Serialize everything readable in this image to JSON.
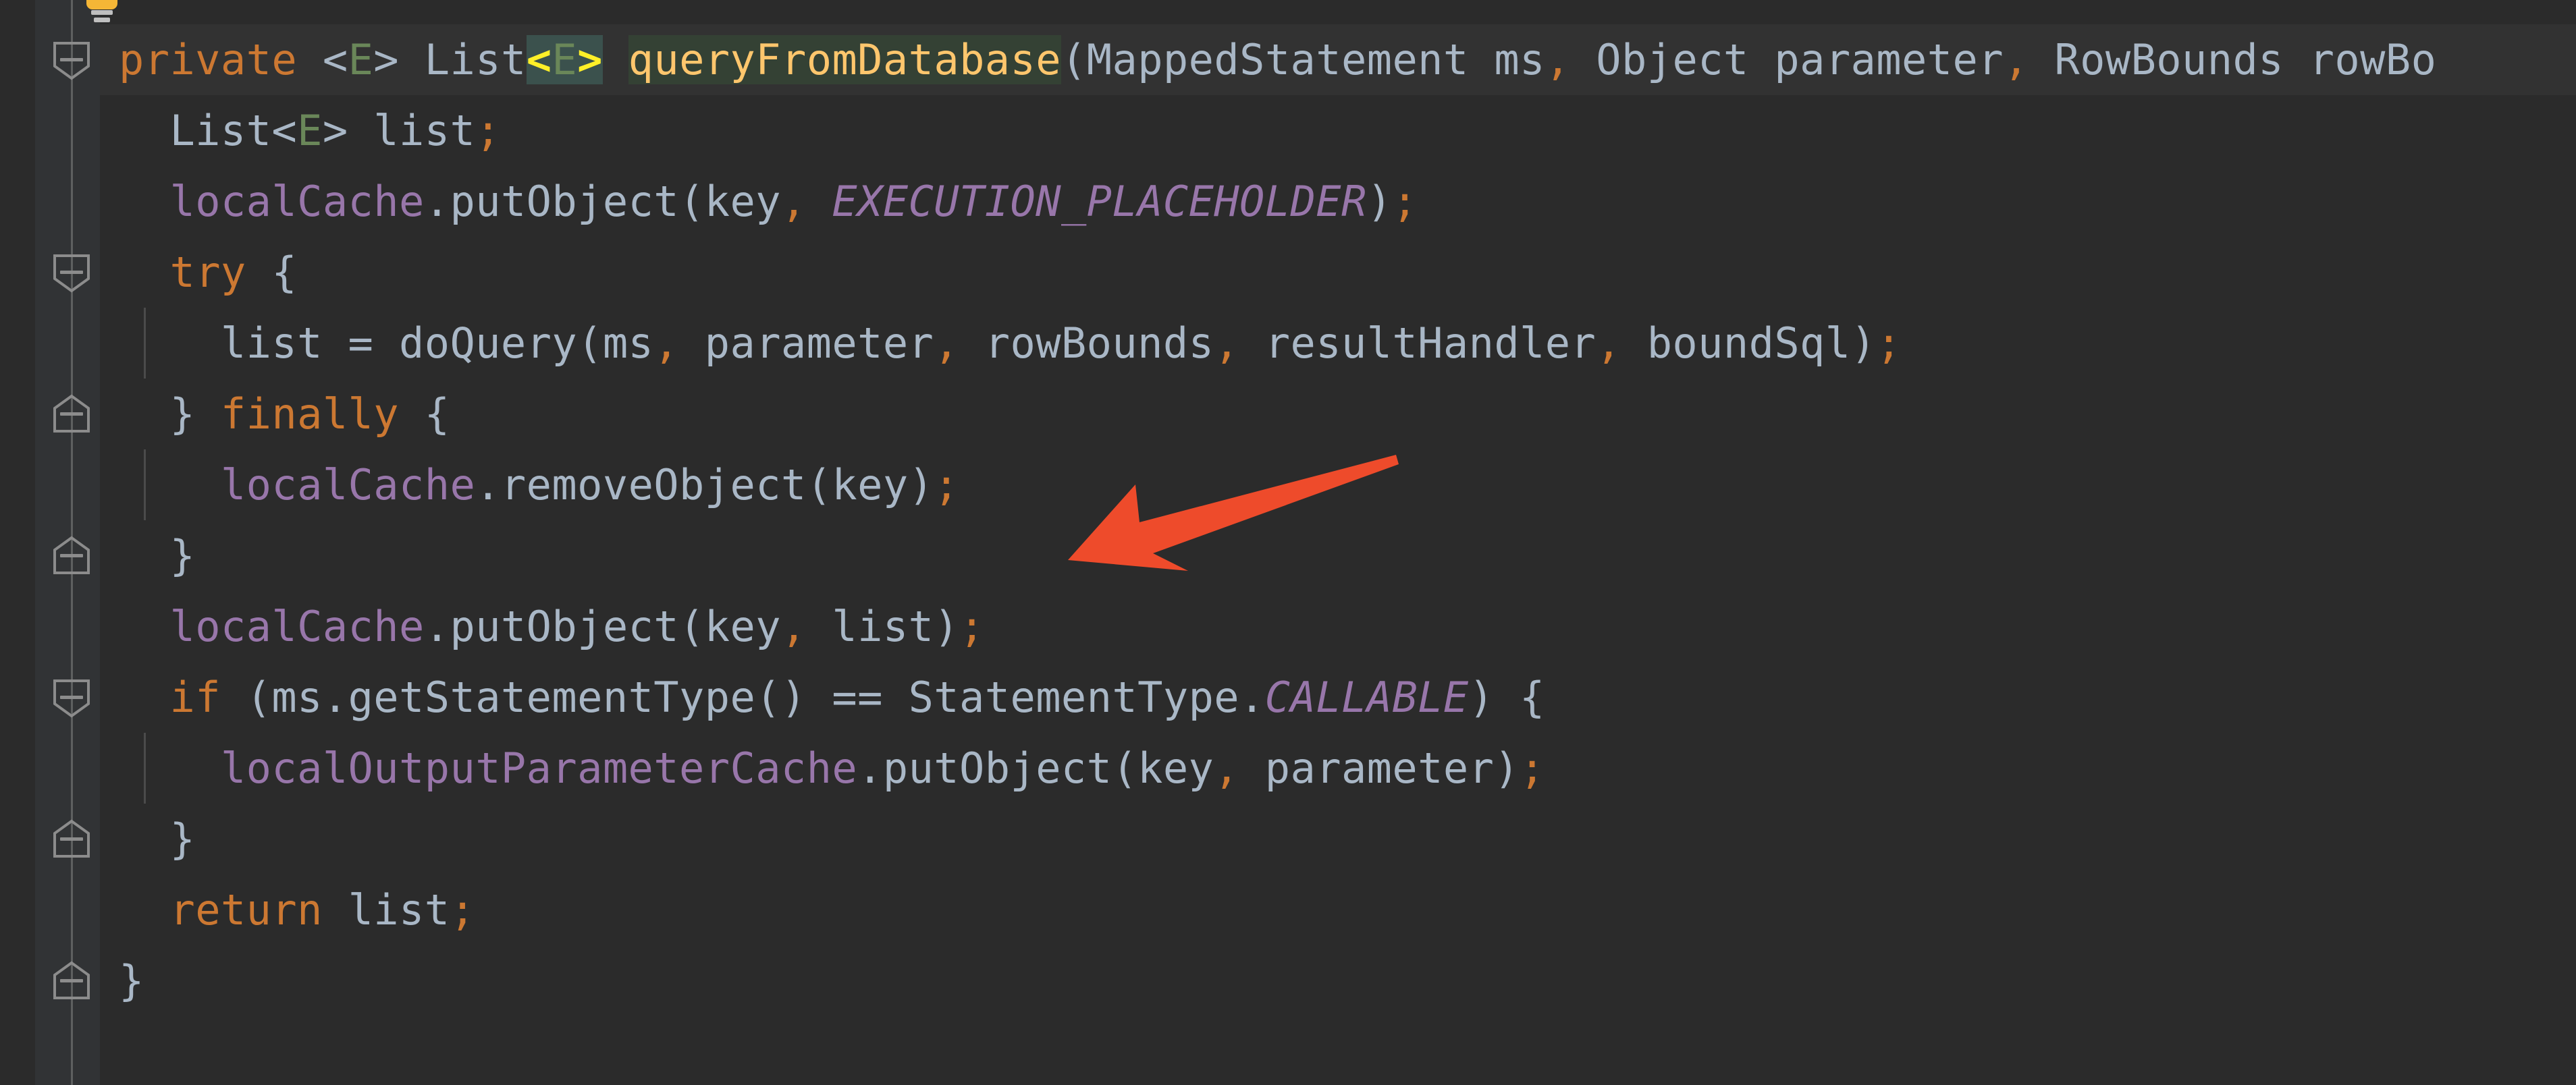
{
  "app": {
    "kind": "code-editor",
    "theme": "darcula",
    "background": "#2B2B2B",
    "gutter_background": "#313335",
    "caret_line_background": "#323232"
  },
  "colors": {
    "keyword": "#CC7832",
    "identifier": "#A9B7C6",
    "field": "#9876AA",
    "static_field": "#9876AA",
    "method": "#FFC66D",
    "generic_param": "#6A8759",
    "punctuation": "#CC7832",
    "usage_highlight": "#344134",
    "bracket_match": "#3B514D",
    "bracket_caret": "#FFEF28",
    "annotation_arrow": "#EE4B2B",
    "bulb": "#F5B636",
    "fold_marker": "#8C8C8C"
  },
  "gutter": {
    "bulb_icon": "lightbulb-intention-icon",
    "fold_markers": [
      {
        "name": "fold-marker-method",
        "direction": "down",
        "glyph": "minus"
      },
      {
        "name": "fold-marker-try",
        "direction": "down",
        "glyph": "minus"
      },
      {
        "name": "fold-marker-finally",
        "direction": "up",
        "glyph": "minus"
      },
      {
        "name": "fold-marker-finally-end",
        "direction": "up",
        "glyph": "minus"
      },
      {
        "name": "fold-marker-if",
        "direction": "down",
        "glyph": "minus"
      },
      {
        "name": "fold-marker-if-end",
        "direction": "up",
        "glyph": "minus"
      },
      {
        "name": "fold-marker-method-end",
        "direction": "up",
        "glyph": "minus"
      }
    ]
  },
  "annotation": {
    "arrow_name": "red-annotation-arrow",
    "color": "#EE4B2B",
    "points_to": "closing brace of finally block",
    "direction": "left-down"
  },
  "code": {
    "language": "java",
    "caret_line_index": 0,
    "lines": [
      {
        "indent_guides": 0,
        "caret": true,
        "tokens": [
          {
            "t": "private",
            "c": "kw"
          },
          {
            "t": " ",
            "c": "id"
          },
          {
            "t": "<",
            "c": "id"
          },
          {
            "t": "E",
            "c": "gen"
          },
          {
            "t": "> ",
            "c": "id"
          },
          {
            "t": "List",
            "c": "id"
          },
          {
            "t": "<",
            "c": "br-y"
          },
          {
            "t": "E",
            "c": "gen hl-brk"
          },
          {
            "t": ">",
            "c": "br-y"
          },
          {
            "t": " ",
            "c": "id"
          },
          {
            "t": "queryFromDatabase",
            "c": "mth hl-usage"
          },
          {
            "t": "(",
            "c": "id"
          },
          {
            "t": "MappedStatement ms",
            "c": "id"
          },
          {
            "t": ",",
            "c": "pn"
          },
          {
            "t": " Object parameter",
            "c": "id"
          },
          {
            "t": ",",
            "c": "pn"
          },
          {
            "t": " RowBounds rowBo",
            "c": "id"
          }
        ]
      },
      {
        "indent_guides": 0,
        "caret": false,
        "tokens": [
          {
            "t": "  List",
            "c": "id"
          },
          {
            "t": "<",
            "c": "id"
          },
          {
            "t": "E",
            "c": "gen"
          },
          {
            "t": "> list",
            "c": "id"
          },
          {
            "t": ";",
            "c": "pn"
          }
        ]
      },
      {
        "indent_guides": 0,
        "caret": false,
        "tokens": [
          {
            "t": "  ",
            "c": "id"
          },
          {
            "t": "localCache",
            "c": "fld"
          },
          {
            "t": ".putObject(key",
            "c": "id"
          },
          {
            "t": ",",
            "c": "pn"
          },
          {
            "t": " ",
            "c": "id"
          },
          {
            "t": "EXECUTION_PLACEHOLDER",
            "c": "sfld"
          },
          {
            "t": ")",
            "c": "id"
          },
          {
            "t": ";",
            "c": "pn"
          }
        ]
      },
      {
        "indent_guides": 0,
        "caret": false,
        "tokens": [
          {
            "t": "  ",
            "c": "id"
          },
          {
            "t": "try",
            "c": "kw"
          },
          {
            "t": " {",
            "c": "id"
          }
        ]
      },
      {
        "indent_guides": 1,
        "caret": false,
        "tokens": [
          {
            "t": "    list = doQuery(ms",
            "c": "id"
          },
          {
            "t": ",",
            "c": "pn"
          },
          {
            "t": " parameter",
            "c": "id"
          },
          {
            "t": ",",
            "c": "pn"
          },
          {
            "t": " rowBounds",
            "c": "id"
          },
          {
            "t": ",",
            "c": "pn"
          },
          {
            "t": " resultHandler",
            "c": "id"
          },
          {
            "t": ",",
            "c": "pn"
          },
          {
            "t": " boundSql)",
            "c": "id"
          },
          {
            "t": ";",
            "c": "pn"
          }
        ]
      },
      {
        "indent_guides": 0,
        "caret": false,
        "tokens": [
          {
            "t": "  } ",
            "c": "id"
          },
          {
            "t": "finally",
            "c": "kw"
          },
          {
            "t": " {",
            "c": "id"
          }
        ]
      },
      {
        "indent_guides": 1,
        "caret": false,
        "tokens": [
          {
            "t": "    ",
            "c": "id"
          },
          {
            "t": "localCache",
            "c": "fld"
          },
          {
            "t": ".removeObject(key)",
            "c": "id"
          },
          {
            "t": ";",
            "c": "pn"
          }
        ]
      },
      {
        "indent_guides": 0,
        "caret": false,
        "tokens": [
          {
            "t": "  }",
            "c": "id"
          }
        ]
      },
      {
        "indent_guides": 0,
        "caret": false,
        "tokens": [
          {
            "t": "  ",
            "c": "id"
          },
          {
            "t": "localCache",
            "c": "fld"
          },
          {
            "t": ".putObject(key",
            "c": "id"
          },
          {
            "t": ",",
            "c": "pn"
          },
          {
            "t": " list)",
            "c": "id"
          },
          {
            "t": ";",
            "c": "pn"
          }
        ]
      },
      {
        "indent_guides": 0,
        "caret": false,
        "tokens": [
          {
            "t": "  ",
            "c": "id"
          },
          {
            "t": "if",
            "c": "kw"
          },
          {
            "t": " (ms.getStatementType() == StatementType.",
            "c": "id"
          },
          {
            "t": "CALLABLE",
            "c": "sfld"
          },
          {
            "t": ") {",
            "c": "id"
          }
        ]
      },
      {
        "indent_guides": 1,
        "caret": false,
        "tokens": [
          {
            "t": "    ",
            "c": "id"
          },
          {
            "t": "localOutputParameterCache",
            "c": "fld"
          },
          {
            "t": ".putObject(key",
            "c": "id"
          },
          {
            "t": ",",
            "c": "pn"
          },
          {
            "t": " parameter)",
            "c": "id"
          },
          {
            "t": ";",
            "c": "pn"
          }
        ]
      },
      {
        "indent_guides": 0,
        "caret": false,
        "tokens": [
          {
            "t": "  }",
            "c": "id"
          }
        ]
      },
      {
        "indent_guides": 0,
        "caret": false,
        "tokens": [
          {
            "t": "  ",
            "c": "id"
          },
          {
            "t": "return",
            "c": "kw"
          },
          {
            "t": " list",
            "c": "id"
          },
          {
            "t": ";",
            "c": "pn"
          }
        ]
      },
      {
        "indent_guides": 0,
        "caret": false,
        "tokens": [
          {
            "t": "}",
            "c": "id"
          }
        ]
      }
    ]
  }
}
